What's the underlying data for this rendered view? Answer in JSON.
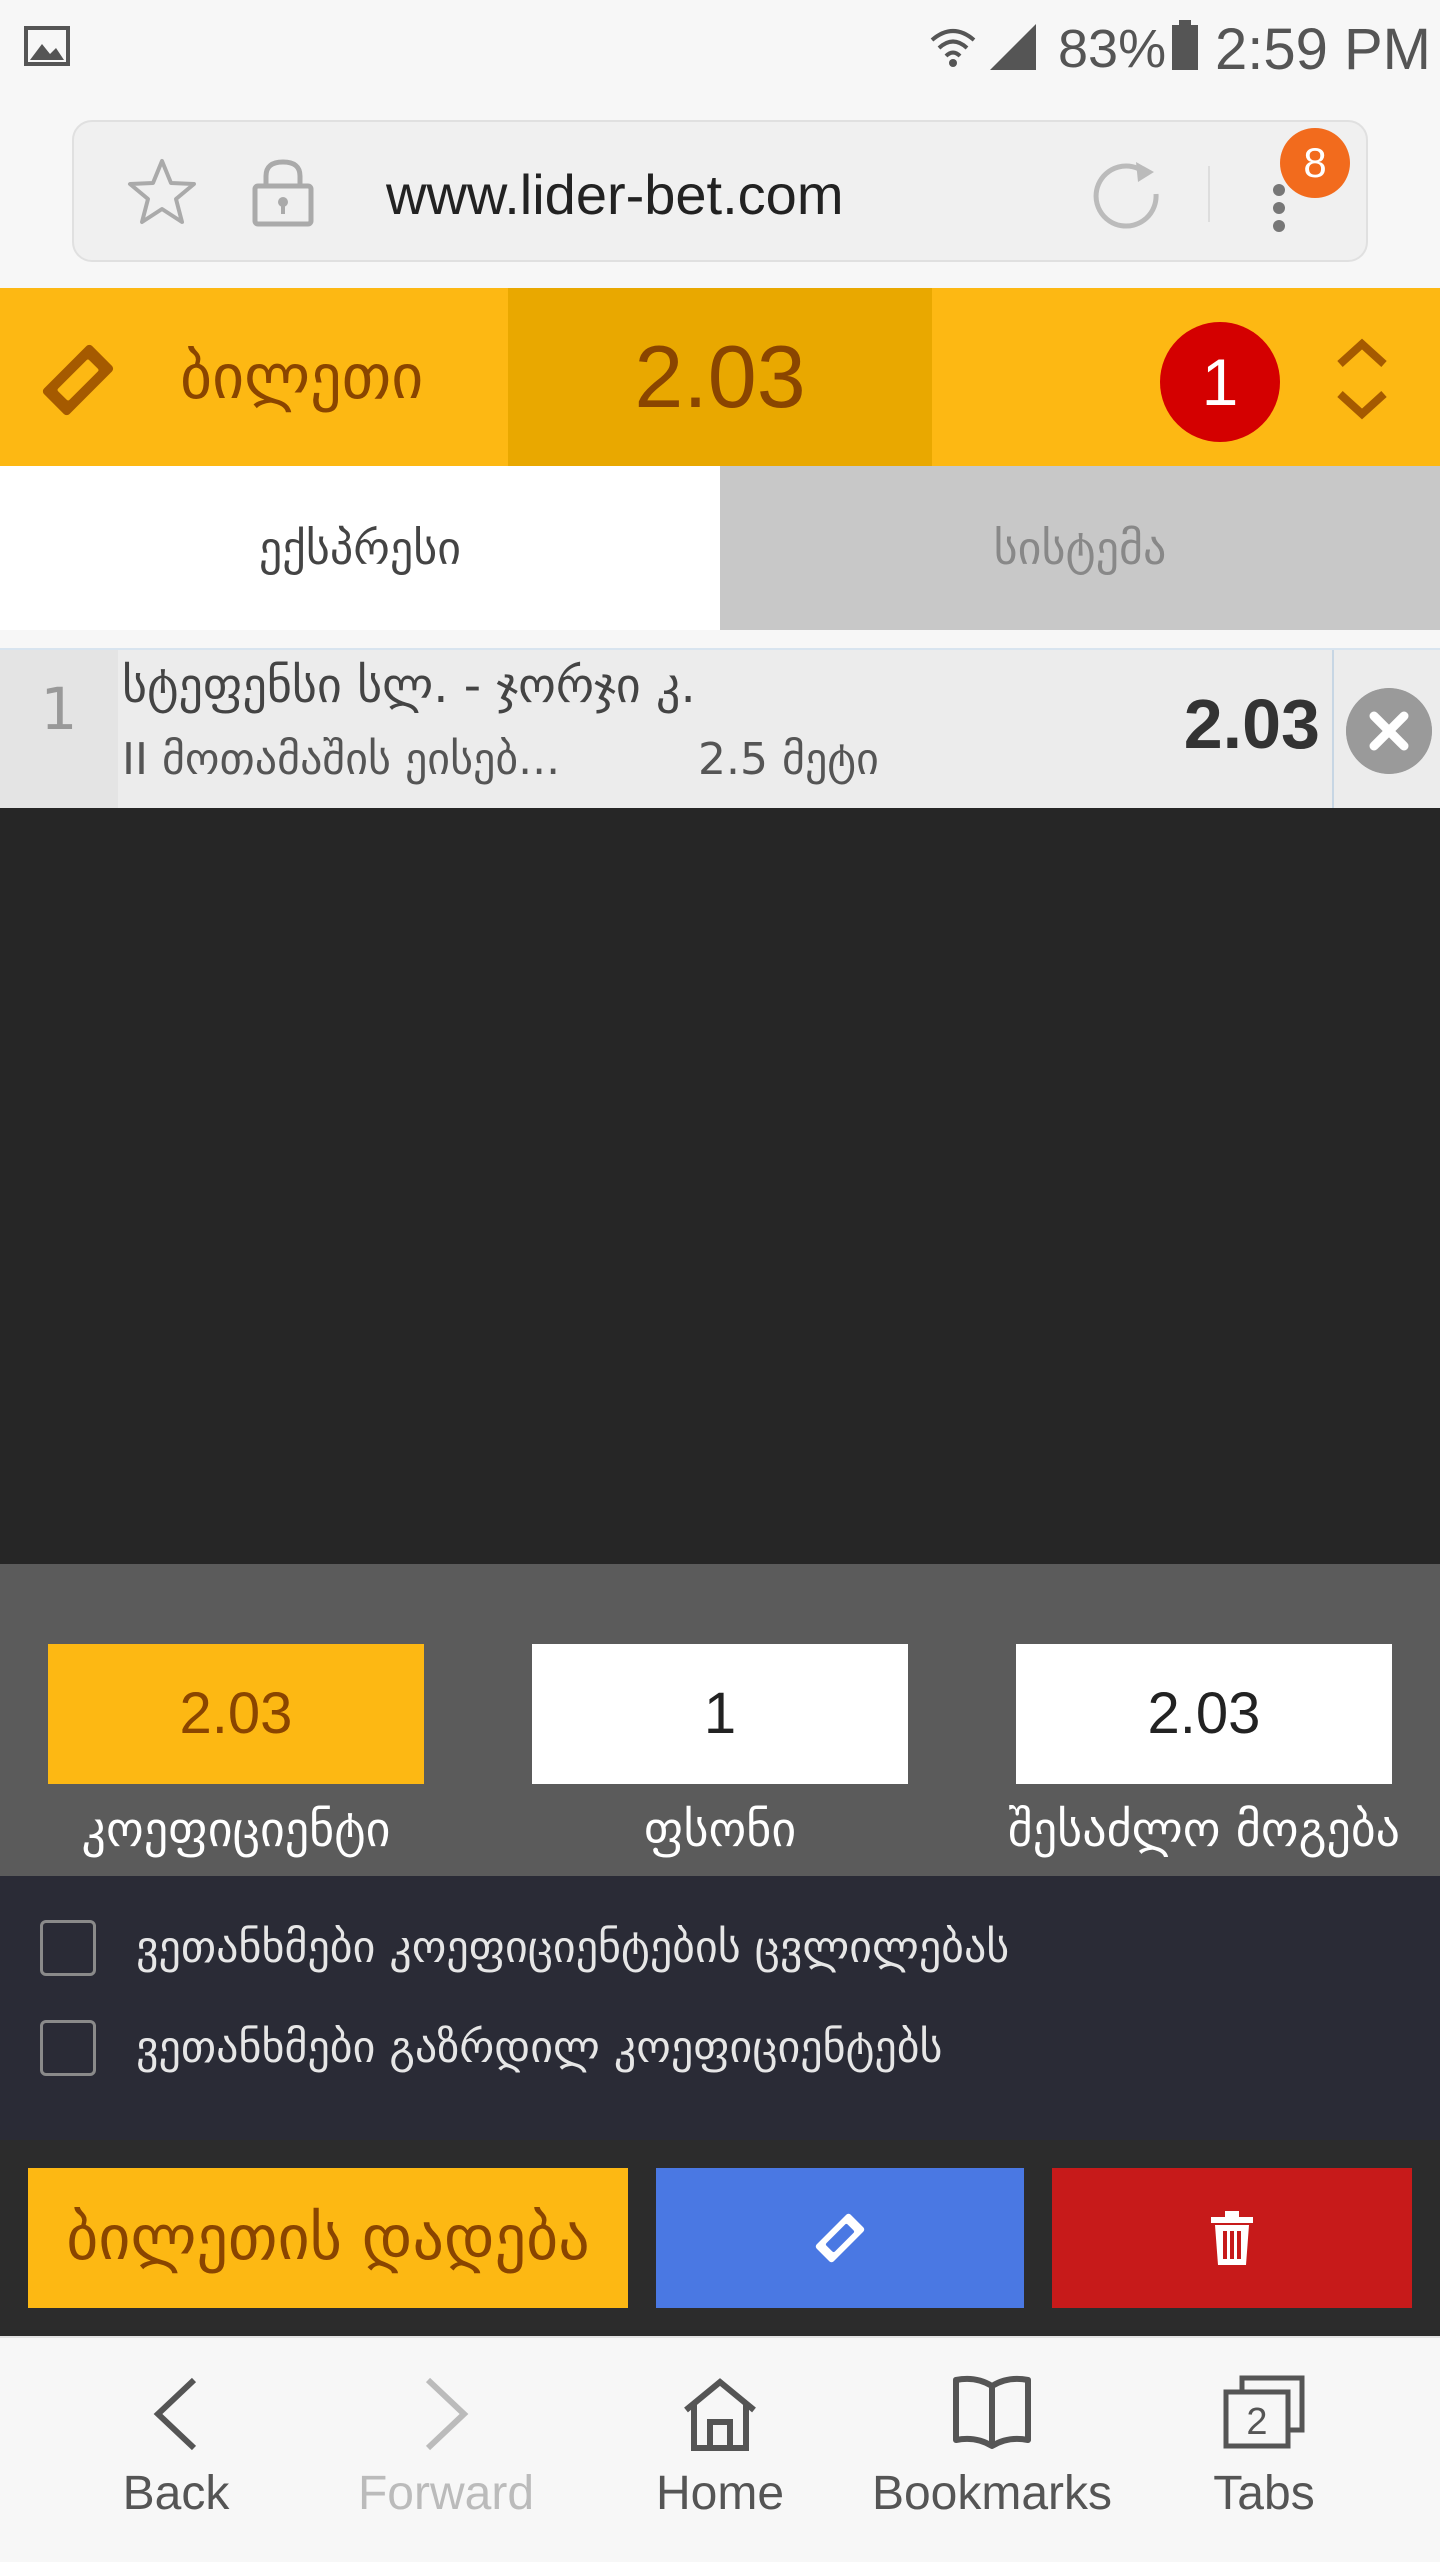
{
  "status_bar": {
    "battery": "83%",
    "time": "2:59 PM"
  },
  "browser": {
    "url": "www.lider-bet.com",
    "notification_count": "8"
  },
  "ticket": {
    "title": "ბილეთი",
    "total_odds": "2.03",
    "selection_count": "1"
  },
  "tabs": [
    {
      "label": "ექსპრესი",
      "active": true
    },
    {
      "label": "სისტემა",
      "active": false
    }
  ],
  "bet": {
    "number": "1",
    "match": "სტეფენსი სლ. - ჯორჯი კ.",
    "market": "II მოთამაშის ეისებ...",
    "selection": "2.5 მეტი",
    "odd": "2.03"
  },
  "summary": {
    "coefficient_value": "2.03",
    "coefficient_label": "კოეფიციენტი",
    "stake_value": "1",
    "stake_label": "ფსონი",
    "possible_win_value": "2.03",
    "possible_win_label": "შესაძლო მოგება"
  },
  "options": [
    {
      "label": "ვეთანხმები კოეფიციენტების ცვლილებას",
      "checked": false
    },
    {
      "label": "ვეთანხმები გაზრდილ კოეფიციენტებს",
      "checked": false
    }
  ],
  "actions": {
    "place_bet": "ბილეთის დადება"
  },
  "bottom_nav": {
    "back": "Back",
    "forward": "Forward",
    "home": "Home",
    "bookmarks": "Bookmarks",
    "tabs": "Tabs",
    "tabs_count": "2"
  },
  "colors": {
    "brand_yellow": "#fdb813",
    "brand_brown": "#8a4500",
    "delete_red": "#c71a1a",
    "ticket_blue": "#4a78e3",
    "count_red": "#d40000"
  }
}
